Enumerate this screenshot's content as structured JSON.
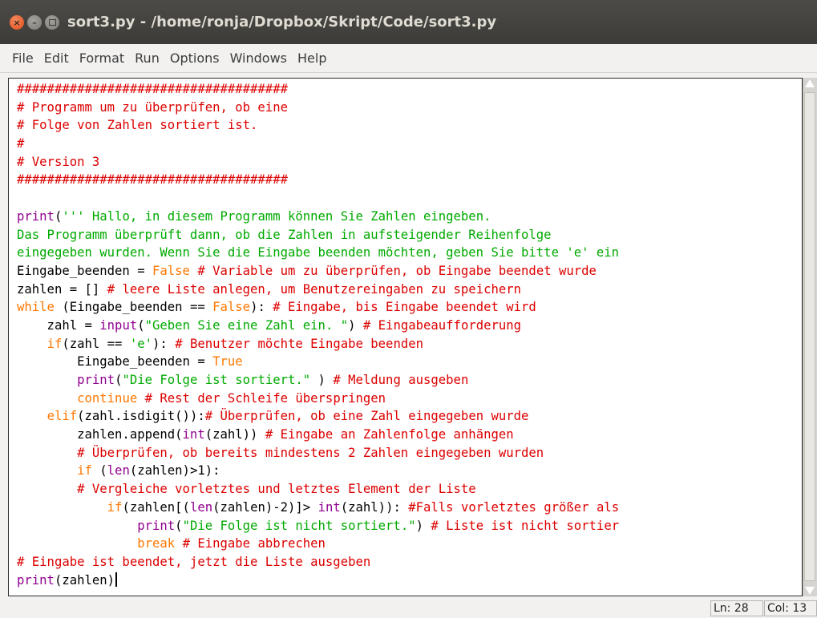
{
  "window": {
    "title": "sort3.py - /home/ronja/Dropbox/Skript/Code/sort3.py",
    "buttons": {
      "close": "×",
      "minimize": "–"
    }
  },
  "menu": {
    "items": [
      "File",
      "Edit",
      "Format",
      "Run",
      "Options",
      "Windows",
      "Help"
    ]
  },
  "colors": {
    "comment": "#dd0000",
    "builtin": "#900090",
    "keyword": "#ff7700",
    "string": "#00aa00",
    "default": "#000000"
  },
  "editor": {
    "lines": [
      [
        {
          "t": "comment",
          "v": "####################################"
        }
      ],
      [
        {
          "t": "comment",
          "v": "# Programm um zu überprüfen, ob eine"
        }
      ],
      [
        {
          "t": "comment",
          "v": "# Folge von Zahlen sortiert ist."
        }
      ],
      [
        {
          "t": "comment",
          "v": "#"
        }
      ],
      [
        {
          "t": "comment",
          "v": "# Version 3"
        }
      ],
      [
        {
          "t": "comment",
          "v": "####################################"
        }
      ],
      [],
      [
        {
          "t": "builtin",
          "v": "print"
        },
        {
          "t": "plain",
          "v": "("
        },
        {
          "t": "string",
          "v": "''' Hallo, in diesem Programm können Sie Zahlen eingeben."
        }
      ],
      [
        {
          "t": "string",
          "v": "Das Programm überprüft dann, ob die Zahlen in aufsteigender Reihenfolge"
        }
      ],
      [
        {
          "t": "string",
          "v": "eingegeben wurden. Wenn Sie die Eingabe beenden möchten, geben Sie bitte 'e' ein"
        }
      ],
      [
        {
          "t": "plain",
          "v": "Eingabe_beenden = "
        },
        {
          "t": "keyword",
          "v": "False"
        },
        {
          "t": "plain",
          "v": " "
        },
        {
          "t": "comment",
          "v": "# Variable um zu überprüfen, ob Eingabe beendet wurde"
        }
      ],
      [
        {
          "t": "plain",
          "v": "zahlen = [] "
        },
        {
          "t": "comment",
          "v": "# leere Liste anlegen, um Benutzereingaben zu speichern"
        }
      ],
      [
        {
          "t": "keyword",
          "v": "while"
        },
        {
          "t": "plain",
          "v": " (Eingabe_beenden == "
        },
        {
          "t": "keyword",
          "v": "False"
        },
        {
          "t": "plain",
          "v": "): "
        },
        {
          "t": "comment",
          "v": "# Eingabe, bis Eingabe beendet wird"
        }
      ],
      [
        {
          "t": "plain",
          "v": "    zahl = "
        },
        {
          "t": "builtin",
          "v": "input"
        },
        {
          "t": "plain",
          "v": "("
        },
        {
          "t": "string",
          "v": "\"Geben Sie eine Zahl ein. \""
        },
        {
          "t": "plain",
          "v": ") "
        },
        {
          "t": "comment",
          "v": "# Eingabeaufforderung"
        }
      ],
      [
        {
          "t": "plain",
          "v": "    "
        },
        {
          "t": "keyword",
          "v": "if"
        },
        {
          "t": "plain",
          "v": "(zahl == "
        },
        {
          "t": "string",
          "v": "'e'"
        },
        {
          "t": "plain",
          "v": "): "
        },
        {
          "t": "comment",
          "v": "# Benutzer möchte Eingabe beenden"
        }
      ],
      [
        {
          "t": "plain",
          "v": "        Eingabe_beenden = "
        },
        {
          "t": "keyword",
          "v": "True"
        }
      ],
      [
        {
          "t": "plain",
          "v": "        "
        },
        {
          "t": "builtin",
          "v": "print"
        },
        {
          "t": "plain",
          "v": "("
        },
        {
          "t": "string",
          "v": "\"Die Folge ist sortiert.\""
        },
        {
          "t": "plain",
          "v": " ) "
        },
        {
          "t": "comment",
          "v": "# Meldung ausgeben"
        }
      ],
      [
        {
          "t": "plain",
          "v": "        "
        },
        {
          "t": "keyword",
          "v": "continue"
        },
        {
          "t": "plain",
          "v": " "
        },
        {
          "t": "comment",
          "v": "# Rest der Schleife überspringen"
        }
      ],
      [
        {
          "t": "plain",
          "v": "    "
        },
        {
          "t": "keyword",
          "v": "elif"
        },
        {
          "t": "plain",
          "v": "(zahl.isdigit()):"
        },
        {
          "t": "comment",
          "v": "# Überprüfen, ob eine Zahl eingegeben wurde"
        }
      ],
      [
        {
          "t": "plain",
          "v": "        zahlen.append("
        },
        {
          "t": "builtin",
          "v": "int"
        },
        {
          "t": "plain",
          "v": "(zahl)) "
        },
        {
          "t": "comment",
          "v": "# Eingabe an Zahlenfolge anhängen"
        }
      ],
      [
        {
          "t": "plain",
          "v": "        "
        },
        {
          "t": "comment",
          "v": "# Überprüfen, ob bereits mindestens 2 Zahlen eingegeben wurden"
        }
      ],
      [
        {
          "t": "plain",
          "v": "        "
        },
        {
          "t": "keyword",
          "v": "if"
        },
        {
          "t": "plain",
          "v": " ("
        },
        {
          "t": "builtin",
          "v": "len"
        },
        {
          "t": "plain",
          "v": "(zahlen)>1):"
        }
      ],
      [
        {
          "t": "plain",
          "v": "        "
        },
        {
          "t": "comment",
          "v": "# Vergleiche vorletztes und letztes Element der Liste"
        }
      ],
      [
        {
          "t": "plain",
          "v": "            "
        },
        {
          "t": "keyword",
          "v": "if"
        },
        {
          "t": "plain",
          "v": "(zahlen[("
        },
        {
          "t": "builtin",
          "v": "len"
        },
        {
          "t": "plain",
          "v": "(zahlen)-2)]> "
        },
        {
          "t": "builtin",
          "v": "int"
        },
        {
          "t": "plain",
          "v": "(zahl)): "
        },
        {
          "t": "comment",
          "v": "#Falls vorletztes größer als"
        }
      ],
      [
        {
          "t": "plain",
          "v": "                "
        },
        {
          "t": "builtin",
          "v": "print"
        },
        {
          "t": "plain",
          "v": "("
        },
        {
          "t": "string",
          "v": "\"Die Folge ist nicht sortiert.\""
        },
        {
          "t": "plain",
          "v": ") "
        },
        {
          "t": "comment",
          "v": "# Liste ist nicht sortier"
        }
      ],
      [
        {
          "t": "plain",
          "v": "                "
        },
        {
          "t": "keyword",
          "v": "break"
        },
        {
          "t": "plain",
          "v": " "
        },
        {
          "t": "comment",
          "v": "# Eingabe abbrechen"
        }
      ],
      [
        {
          "t": "comment",
          "v": "# Eingabe ist beendet, jetzt die Liste ausgeben"
        }
      ],
      [
        {
          "t": "builtin",
          "v": "print"
        },
        {
          "t": "plain",
          "v": "(zahlen)"
        }
      ]
    ],
    "caret_line": 28
  },
  "status": {
    "line": "Ln: 28",
    "col": "Col: 13"
  }
}
